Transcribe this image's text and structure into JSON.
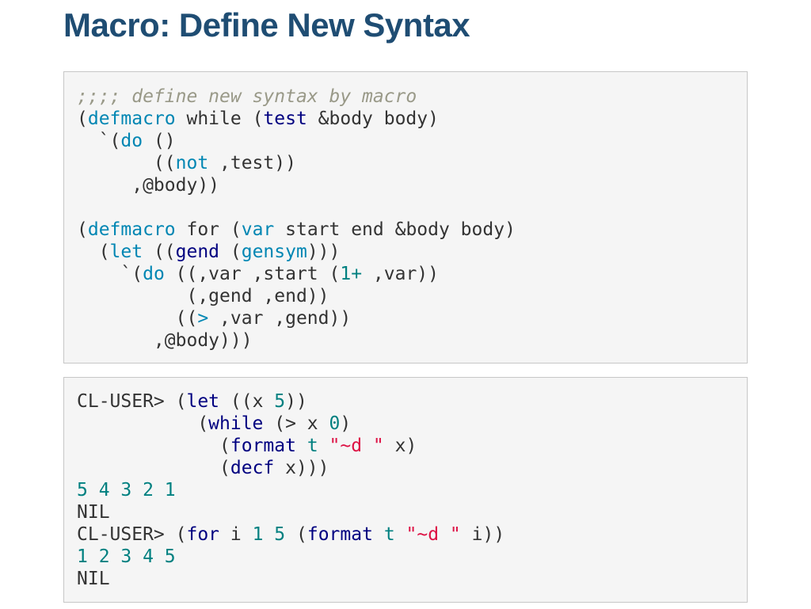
{
  "title": "Macro: Define New Syntax",
  "code_block_1": [
    [
      {
        "t": ";;;; define new syntax by macro",
        "c": "cmt"
      }
    ],
    [
      {
        "t": "(",
        "c": "pl"
      },
      {
        "t": "defmacro",
        "c": "kw"
      },
      {
        "t": " while (",
        "c": "pl"
      },
      {
        "t": "test",
        "c": "nm"
      },
      {
        "t": " &body body)",
        "c": "pl"
      }
    ],
    [
      {
        "t": "  `(",
        "c": "pl"
      },
      {
        "t": "do",
        "c": "kw"
      },
      {
        "t": " ()",
        "c": "pl"
      }
    ],
    [
      {
        "t": "       ((",
        "c": "pl"
      },
      {
        "t": "not",
        "c": "kw"
      },
      {
        "t": " ,test))",
        "c": "pl"
      }
    ],
    [
      {
        "t": "     ,@body))",
        "c": "pl"
      }
    ],
    [
      {
        "t": "",
        "c": "pl"
      }
    ],
    [
      {
        "t": "(",
        "c": "pl"
      },
      {
        "t": "defmacro",
        "c": "kw"
      },
      {
        "t": " for (",
        "c": "pl"
      },
      {
        "t": "var",
        "c": "kw"
      },
      {
        "t": " start end &body body)",
        "c": "pl"
      }
    ],
    [
      {
        "t": "  (",
        "c": "pl"
      },
      {
        "t": "let",
        "c": "kw"
      },
      {
        "t": " ((",
        "c": "pl"
      },
      {
        "t": "gend",
        "c": "nm"
      },
      {
        "t": " (",
        "c": "pl"
      },
      {
        "t": "gensym",
        "c": "kw"
      },
      {
        "t": ")))",
        "c": "pl"
      }
    ],
    [
      {
        "t": "    `(",
        "c": "pl"
      },
      {
        "t": "do",
        "c": "kw"
      },
      {
        "t": " ((,var ,start (",
        "c": "pl"
      },
      {
        "t": "1+",
        "c": "num"
      },
      {
        "t": " ,var))",
        "c": "pl"
      }
    ],
    [
      {
        "t": "          (,gend ,end))",
        "c": "pl"
      }
    ],
    [
      {
        "t": "         ((",
        "c": "pl"
      },
      {
        "t": ">",
        "c": "kw"
      },
      {
        "t": " ,var ,gend))",
        "c": "pl"
      }
    ],
    [
      {
        "t": "       ,@body)))",
        "c": "pl"
      }
    ]
  ],
  "code_block_2": [
    [
      {
        "t": "CL-USER> (",
        "c": "pl"
      },
      {
        "t": "let",
        "c": "nm"
      },
      {
        "t": " ((x ",
        "c": "pl"
      },
      {
        "t": "5",
        "c": "num"
      },
      {
        "t": "))",
        "c": "pl"
      }
    ],
    [
      {
        "t": "           (",
        "c": "pl"
      },
      {
        "t": "while",
        "c": "nm"
      },
      {
        "t": " (> x ",
        "c": "pl"
      },
      {
        "t": "0",
        "c": "num"
      },
      {
        "t": ")",
        "c": "pl"
      }
    ],
    [
      {
        "t": "             (",
        "c": "pl"
      },
      {
        "t": "format",
        "c": "nm"
      },
      {
        "t": " ",
        "c": "pl"
      },
      {
        "t": "t",
        "c": "num"
      },
      {
        "t": " ",
        "c": "pl"
      },
      {
        "t": "\"~d \"",
        "c": "str"
      },
      {
        "t": " x)",
        "c": "pl"
      }
    ],
    [
      {
        "t": "             (",
        "c": "pl"
      },
      {
        "t": "decf",
        "c": "nm"
      },
      {
        "t": " x)))",
        "c": "pl"
      }
    ],
    [
      {
        "t": "5 4 3 2 1",
        "c": "num"
      }
    ],
    [
      {
        "t": "NIL",
        "c": "pl"
      }
    ],
    [
      {
        "t": "CL-USER> (",
        "c": "pl"
      },
      {
        "t": "for",
        "c": "nm"
      },
      {
        "t": " i ",
        "c": "pl"
      },
      {
        "t": "1",
        "c": "num"
      },
      {
        "t": " ",
        "c": "pl"
      },
      {
        "t": "5",
        "c": "num"
      },
      {
        "t": " (",
        "c": "pl"
      },
      {
        "t": "format",
        "c": "nm"
      },
      {
        "t": " ",
        "c": "pl"
      },
      {
        "t": "t",
        "c": "num"
      },
      {
        "t": " ",
        "c": "pl"
      },
      {
        "t": "\"~d \"",
        "c": "str"
      },
      {
        "t": " i))",
        "c": "pl"
      }
    ],
    [
      {
        "t": "1 2 3 4 5",
        "c": "num"
      }
    ],
    [
      {
        "t": "NIL",
        "c": "pl"
      }
    ]
  ]
}
